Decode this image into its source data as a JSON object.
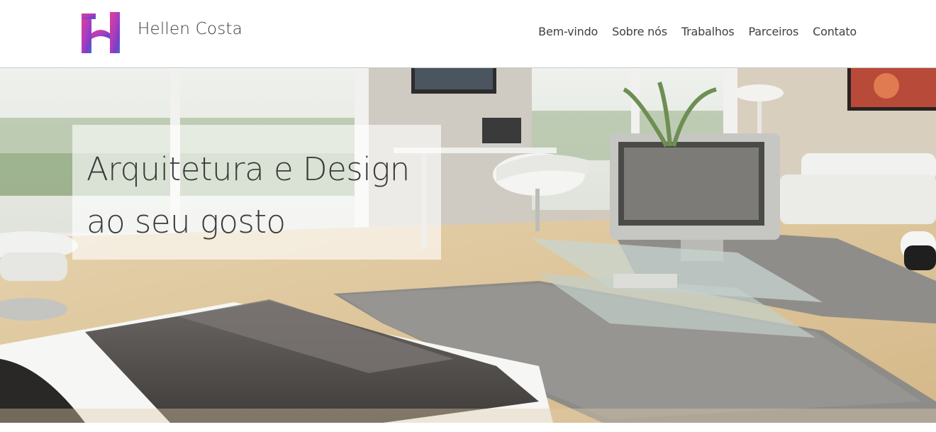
{
  "header": {
    "brand": "Hellen Costa",
    "logo_icon": "h-monogram-logo-icon",
    "nav": [
      {
        "label": "Bem-vindo"
      },
      {
        "label": "Sobre nós"
      },
      {
        "label": "Trabalhos"
      },
      {
        "label": "Parceiros"
      },
      {
        "label": "Contato"
      }
    ]
  },
  "hero": {
    "title_line1": "Arquitetura e Design",
    "title_line2": "ao seu gosto",
    "image": "modern-living-room-interior-photo"
  },
  "colors": {
    "header_bg": "#ffffff",
    "text": "#3a3a3a",
    "logo_gradient": [
      "#e0408a",
      "#7a3fc4",
      "#3d6fd8"
    ]
  }
}
